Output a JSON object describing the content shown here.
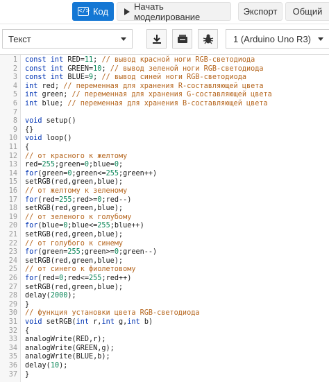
{
  "topbar": {
    "code_label": "Код",
    "code_icon": "code-brackets-icon",
    "simulate_label": "Начать моделирование",
    "export_label": "Экспорт",
    "share_label": "Общий"
  },
  "toolbar": {
    "mode_value": "Текст",
    "device_value": "1 (Arduino Uno R3)",
    "icons": [
      "download-icon",
      "library-icon",
      "debug-bug-icon"
    ]
  },
  "colors": {
    "accent": "#1477d4",
    "keyword": "#0033b3",
    "number": "#098658",
    "comment": "#b5651d"
  },
  "code_lines": [
    [
      [
        "kw",
        "const int "
      ],
      [
        "t",
        "RED="
      ],
      [
        "num",
        "11"
      ],
      [
        "t",
        "; "
      ],
      [
        "com",
        "// вывод красной ноги RGB-светодиода"
      ]
    ],
    [
      [
        "kw",
        "const int "
      ],
      [
        "t",
        "GREEN="
      ],
      [
        "num",
        "10"
      ],
      [
        "t",
        "; "
      ],
      [
        "com",
        "// вывод зеленой ноги RGB-светодиода"
      ]
    ],
    [
      [
        "kw",
        "const int "
      ],
      [
        "t",
        "BLUE="
      ],
      [
        "num",
        "9"
      ],
      [
        "t",
        "; "
      ],
      [
        "com",
        "// вывод синей ноги RGB-светодиода"
      ]
    ],
    [
      [
        "kw",
        "int "
      ],
      [
        "t",
        "red; "
      ],
      [
        "com",
        "// переменная для хранения R-составляющей цвета"
      ]
    ],
    [
      [
        "kw",
        "int "
      ],
      [
        "t",
        "green; "
      ],
      [
        "com",
        "// переменная для хранения G-составляющей цвета"
      ]
    ],
    [
      [
        "kw",
        "int "
      ],
      [
        "t",
        "blue; "
      ],
      [
        "com",
        "// переменная для хранения B-составляющей цвета"
      ]
    ],
    [],
    [
      [
        "kw",
        "void "
      ],
      [
        "t",
        "setup()"
      ]
    ],
    [
      [
        "t",
        "{}"
      ]
    ],
    [
      [
        "kw",
        "void "
      ],
      [
        "t",
        "loop()"
      ]
    ],
    [
      [
        "t",
        "{"
      ]
    ],
    [
      [
        "com",
        "// от красного к желтому"
      ]
    ],
    [
      [
        "t",
        "red="
      ],
      [
        "num",
        "255"
      ],
      [
        "t",
        ";green="
      ],
      [
        "num",
        "0"
      ],
      [
        "t",
        ";blue="
      ],
      [
        "num",
        "0"
      ],
      [
        "t",
        ";"
      ]
    ],
    [
      [
        "kw",
        "for"
      ],
      [
        "t",
        "(green="
      ],
      [
        "num",
        "0"
      ],
      [
        "t",
        ";green<="
      ],
      [
        "num",
        "255"
      ],
      [
        "t",
        ";green++)"
      ]
    ],
    [
      [
        "t",
        "setRGB(red,green,blue);"
      ]
    ],
    [
      [
        "com",
        "// от желтому к зеленому"
      ]
    ],
    [
      [
        "kw",
        "for"
      ],
      [
        "t",
        "(red="
      ],
      [
        "num",
        "255"
      ],
      [
        "t",
        ";red>="
      ],
      [
        "num",
        "0"
      ],
      [
        "t",
        ";red--)"
      ]
    ],
    [
      [
        "t",
        "setRGB(red,green,blue);"
      ]
    ],
    [
      [
        "com",
        "// от зеленого к голубому"
      ]
    ],
    [
      [
        "kw",
        "for"
      ],
      [
        "t",
        "(blue="
      ],
      [
        "num",
        "0"
      ],
      [
        "t",
        ";blue<="
      ],
      [
        "num",
        "255"
      ],
      [
        "t",
        ";blue++)"
      ]
    ],
    [
      [
        "t",
        "setRGB(red,green,blue);"
      ]
    ],
    [
      [
        "com",
        "// от голубого к синему"
      ]
    ],
    [
      [
        "kw",
        "for"
      ],
      [
        "t",
        "(green="
      ],
      [
        "num",
        "255"
      ],
      [
        "t",
        ";green>="
      ],
      [
        "num",
        "0"
      ],
      [
        "t",
        ";green--)"
      ]
    ],
    [
      [
        "t",
        "setRGB(red,green,blue);"
      ]
    ],
    [
      [
        "com",
        "// от синего к фиолетовому"
      ]
    ],
    [
      [
        "kw",
        "for"
      ],
      [
        "t",
        "(red="
      ],
      [
        "num",
        "0"
      ],
      [
        "t",
        ";red<="
      ],
      [
        "num",
        "255"
      ],
      [
        "t",
        ";red++)"
      ]
    ],
    [
      [
        "t",
        "setRGB(red,green,blue);"
      ]
    ],
    [
      [
        "t",
        "delay("
      ],
      [
        "num",
        "2000"
      ],
      [
        "t",
        ");"
      ]
    ],
    [
      [
        "t",
        "}"
      ]
    ],
    [
      [
        "com",
        "// функция установки цвета RGB-светодиода"
      ]
    ],
    [
      [
        "kw",
        "void "
      ],
      [
        "t",
        "setRGB("
      ],
      [
        "kw",
        "int "
      ],
      [
        "t",
        "r,"
      ],
      [
        "kw",
        "int "
      ],
      [
        "t",
        "g,"
      ],
      [
        "kw",
        "int "
      ],
      [
        "t",
        "b)"
      ]
    ],
    [
      [
        "t",
        "{"
      ]
    ],
    [
      [
        "t",
        "analogWrite(RED,r);"
      ]
    ],
    [
      [
        "t",
        "analogWrite(GREEN,g);"
      ]
    ],
    [
      [
        "t",
        "analogWrite(BLUE,b);"
      ]
    ],
    [
      [
        "t",
        "delay("
      ],
      [
        "num",
        "10"
      ],
      [
        "t",
        ");"
      ]
    ],
    [
      [
        "t",
        "}"
      ]
    ]
  ]
}
